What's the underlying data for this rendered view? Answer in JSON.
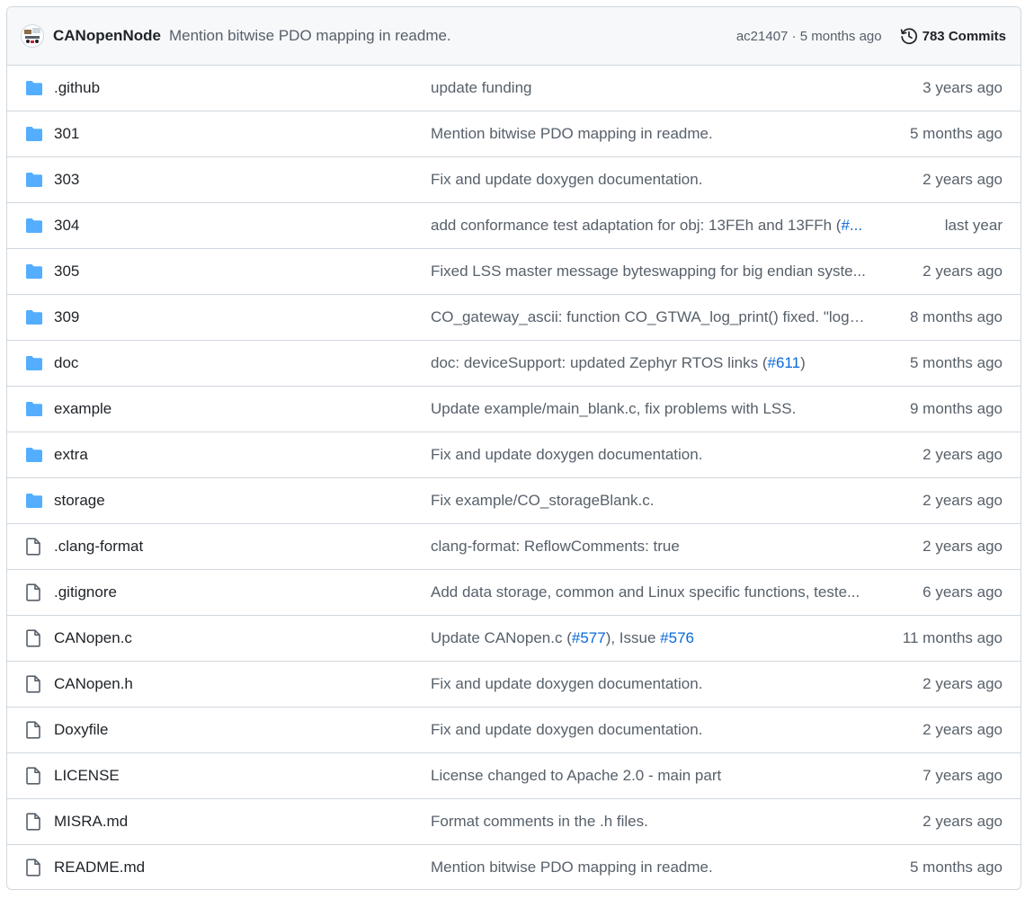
{
  "header": {
    "author": "CANopenNode",
    "message": "Mention bitwise PDO mapping in readme.",
    "meta": "ac21407 · 5 months ago",
    "commits_label": "783 Commits",
    "history_icon": "history-icon",
    "avatar_icon": "avatar"
  },
  "colors": {
    "folder": "#54aeff",
    "file": "#57606a",
    "link": "#0969da",
    "muted": "#57606a",
    "border": "#d0d7de",
    "header_bg": "#f6f8fa"
  },
  "rows": [
    {
      "type": "folder",
      "name": ".github",
      "message": [
        {
          "t": "update funding"
        }
      ],
      "age": "3 years ago"
    },
    {
      "type": "folder",
      "name": "301",
      "message": [
        {
          "t": "Mention bitwise PDO mapping in readme."
        }
      ],
      "age": "5 months ago"
    },
    {
      "type": "folder",
      "name": "303",
      "message": [
        {
          "t": "Fix and update doxygen documentation."
        }
      ],
      "age": "2 years ago"
    },
    {
      "type": "folder",
      "name": "304",
      "message": [
        {
          "t": "add conformance test adaptation for obj: 13FEh and 13FFh ("
        },
        {
          "t": "#...",
          "link": true
        }
      ],
      "age": "last year"
    },
    {
      "type": "folder",
      "name": "305",
      "message": [
        {
          "t": "Fixed LSS master message byteswapping for big endian syste..."
        }
      ],
      "age": "2 years ago"
    },
    {
      "type": "folder",
      "name": "309",
      "message": [
        {
          "t": "CO_gateway_ascii: function CO_GTWA_log_print() fixed. \"log\" ..."
        }
      ],
      "age": "8 months ago"
    },
    {
      "type": "folder",
      "name": "doc",
      "message": [
        {
          "t": "doc: deviceSupport: updated Zephyr RTOS links ("
        },
        {
          "t": "#611",
          "link": true
        },
        {
          "t": ")"
        }
      ],
      "age": "5 months ago"
    },
    {
      "type": "folder",
      "name": "example",
      "message": [
        {
          "t": "Update example/main_blank.c, fix problems with LSS."
        }
      ],
      "age": "9 months ago"
    },
    {
      "type": "folder",
      "name": "extra",
      "message": [
        {
          "t": "Fix and update doxygen documentation."
        }
      ],
      "age": "2 years ago"
    },
    {
      "type": "folder",
      "name": "storage",
      "message": [
        {
          "t": "Fix example/CO_storageBlank.c."
        }
      ],
      "age": "2 years ago"
    },
    {
      "type": "file",
      "name": ".clang-format",
      "message": [
        {
          "t": "clang-format: ReflowComments: true"
        }
      ],
      "age": "2 years ago"
    },
    {
      "type": "file",
      "name": ".gitignore",
      "message": [
        {
          "t": "Add data storage, common and Linux specific functions, teste..."
        }
      ],
      "age": "6 years ago"
    },
    {
      "type": "file",
      "name": "CANopen.c",
      "message": [
        {
          "t": "Update CANopen.c ("
        },
        {
          "t": "#577",
          "link": true
        },
        {
          "t": "), Issue "
        },
        {
          "t": "#576",
          "link": true
        }
      ],
      "age": "11 months ago"
    },
    {
      "type": "file",
      "name": "CANopen.h",
      "message": [
        {
          "t": "Fix and update doxygen documentation."
        }
      ],
      "age": "2 years ago"
    },
    {
      "type": "file",
      "name": "Doxyfile",
      "message": [
        {
          "t": "Fix and update doxygen documentation."
        }
      ],
      "age": "2 years ago"
    },
    {
      "type": "file",
      "name": "LICENSE",
      "message": [
        {
          "t": "License changed to Apache 2.0 - main part"
        }
      ],
      "age": "7 years ago"
    },
    {
      "type": "file",
      "name": "MISRA.md",
      "message": [
        {
          "t": "Format comments in the .h files."
        }
      ],
      "age": "2 years ago"
    },
    {
      "type": "file",
      "name": "README.md",
      "message": [
        {
          "t": "Mention bitwise PDO mapping in readme."
        }
      ],
      "age": "5 months ago"
    }
  ]
}
